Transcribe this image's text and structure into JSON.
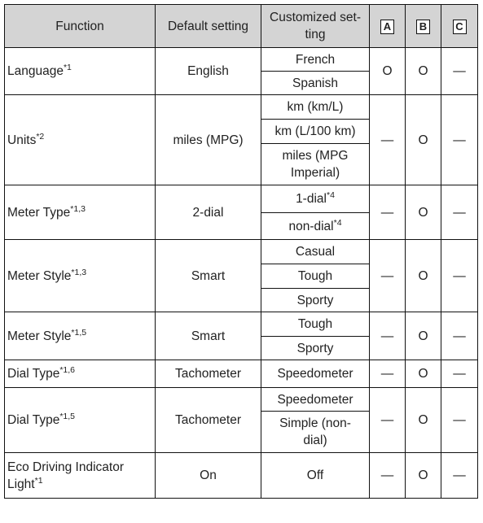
{
  "headers": {
    "function": "Function",
    "default": "Default setting",
    "custom": "Customized set-ting",
    "a": "A",
    "b": "B",
    "c": "C"
  },
  "rows": [
    {
      "function": "Language",
      "note": "*1",
      "default": "English",
      "custom": [
        "French",
        "Spanish"
      ],
      "a": "O",
      "b": "O",
      "c": "—"
    },
    {
      "function": "Units",
      "note": "*2",
      "default": "miles (MPG)",
      "custom": [
        "km (km/L)",
        "km (L/100 km)",
        "miles (MPG Imperial)"
      ],
      "a": "—",
      "b": "O",
      "c": "—"
    },
    {
      "function": "Meter Type",
      "note": "*1,3",
      "default": "2-dial",
      "custom": [
        "1-dial",
        "non-dial"
      ],
      "custom_notes": [
        "*4",
        "*4"
      ],
      "a": "—",
      "b": "O",
      "c": "—"
    },
    {
      "function": "Meter Style",
      "note": "*1,3",
      "default": "Smart",
      "custom": [
        "Casual",
        "Tough",
        "Sporty"
      ],
      "a": "—",
      "b": "O",
      "c": "—"
    },
    {
      "function": "Meter Style",
      "note": "*1,5",
      "default": "Smart",
      "custom": [
        "Tough",
        "Sporty"
      ],
      "a": "—",
      "b": "O",
      "c": "—"
    },
    {
      "function": "Dial Type",
      "note": "*1,6",
      "default": "Tachometer",
      "custom": [
        "Speedometer"
      ],
      "a": "—",
      "b": "O",
      "c": "—"
    },
    {
      "function": "Dial Type",
      "note": "*1,5",
      "default": "Tachometer",
      "custom": [
        "Speedometer",
        "Simple (non-dial)"
      ],
      "a": "—",
      "b": "O",
      "c": "—"
    },
    {
      "function": "Eco Driving Indicator Light",
      "note": "*1",
      "default": "On",
      "custom": [
        "Off"
      ],
      "a": "—",
      "b": "O",
      "c": "—"
    }
  ]
}
